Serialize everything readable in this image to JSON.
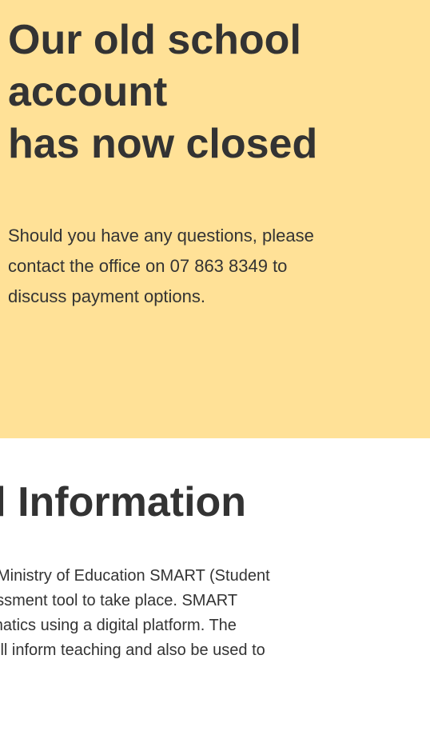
{
  "notice": {
    "heading_lines": [
      "Our old school",
      "account",
      "has now closed"
    ],
    "body_lines": [
      "Should you have any questions, please",
      "contact the office on 07 863 8349 to",
      "discuss payment options."
    ],
    "background_color": "#ffe197"
  },
  "section": {
    "heading": "t Tool Information",
    "body_lines": [
      "w Ministry of Education SMART (Student",
      "sessment tool to take place. SMART",
      "hematics using a digital platform.  The",
      "ill inform teaching and also be used to"
    ]
  }
}
